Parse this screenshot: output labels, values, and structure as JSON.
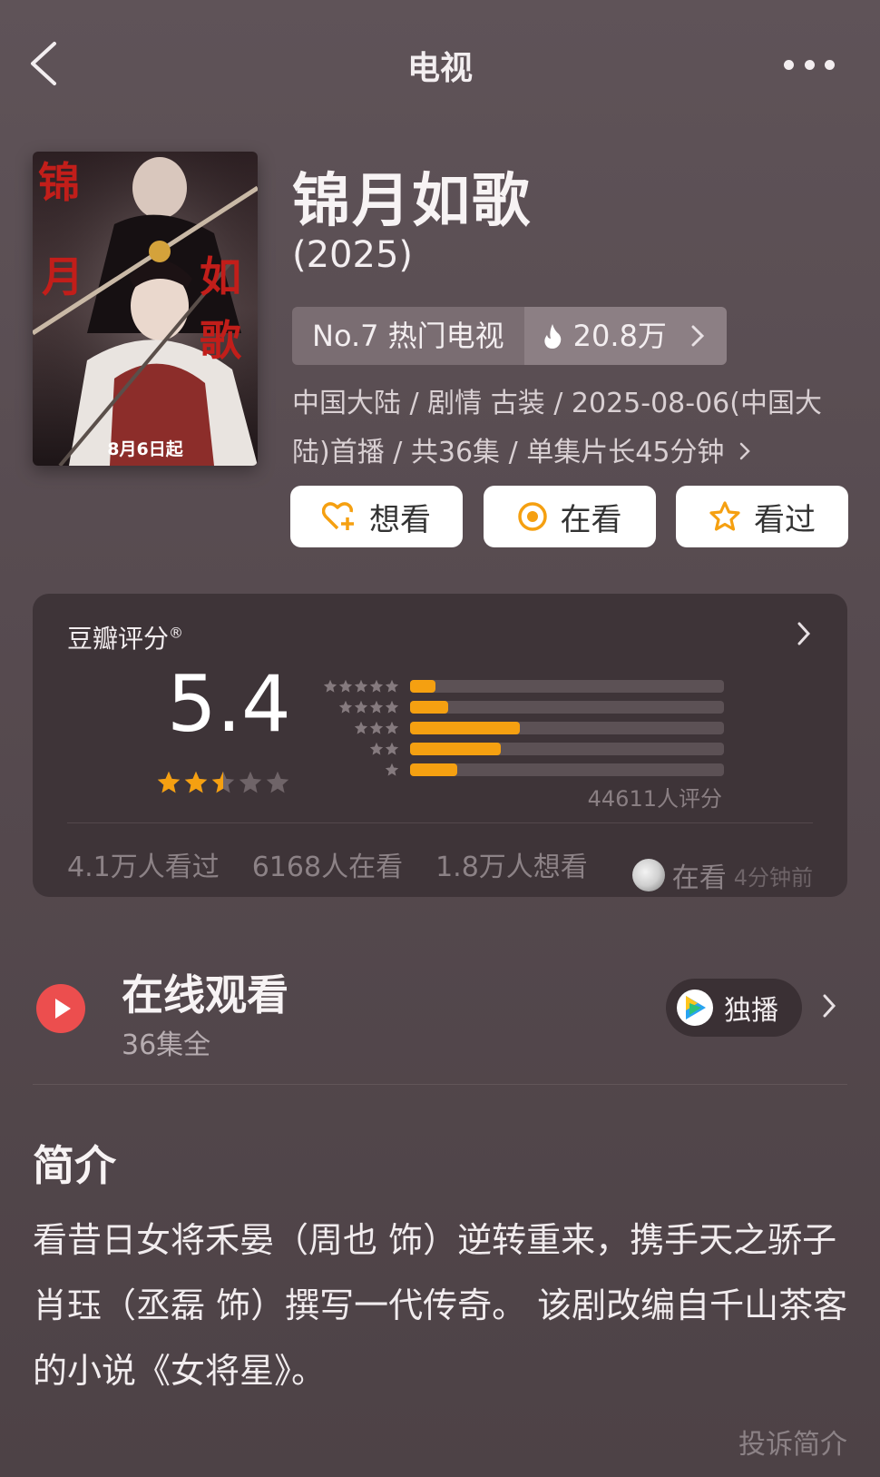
{
  "nav": {
    "title": "电视"
  },
  "show": {
    "title": "锦月如歌",
    "year": "(2025)",
    "rank_label": "No.7 热门电视",
    "heat": "20.8万",
    "meta": "中国大陆 / 剧情 古装 / 2025-08-06(中国大陆)首播 / 共36集 / 单集片长45分钟"
  },
  "poster": {
    "title_chars": [
      "锦",
      "月",
      "如",
      "歌"
    ],
    "date_text": "8月6日起"
  },
  "actions": [
    {
      "label": "想看",
      "icon": "heart-plus-icon"
    },
    {
      "label": "在看",
      "icon": "target-icon"
    },
    {
      "label": "看过",
      "icon": "star-outline-icon"
    }
  ],
  "rating": {
    "label": "豆瓣评分",
    "registered": "®",
    "score": "5.4",
    "stars": 2.5,
    "count": "44611人评分",
    "distribution": [
      {
        "stars": 5,
        "fraction": 0.08
      },
      {
        "stars": 4,
        "fraction": 0.12
      },
      {
        "stars": 3,
        "fraction": 0.35
      },
      {
        "stars": 2,
        "fraction": 0.29
      },
      {
        "stars": 1,
        "fraction": 0.15
      }
    ],
    "watched": "4.1万人看过",
    "watching": "6168人在看",
    "wish": "1.8万人想看",
    "activity_status": "在看",
    "activity_time": "4分钟前"
  },
  "online": {
    "title": "在线观看",
    "episodes": "36集全",
    "exclusive_label": "独播"
  },
  "intro": {
    "heading": "简介",
    "text": "看昔日女将禾晏（周也 饰）逆转重来，携手天之骄子肖珏（丞磊 饰）撰写一代传奇。 该剧改编自千山茶客的小说《女将星》。",
    "report": "投诉简介"
  },
  "colors": {
    "accent": "#f5a011",
    "play_red": "#ec4e4e",
    "card_bg": "#3e3438"
  }
}
